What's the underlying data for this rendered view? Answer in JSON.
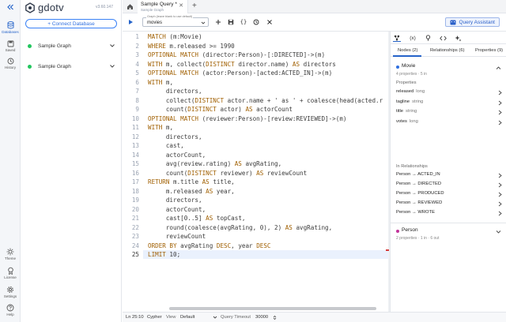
{
  "app": {
    "name": "gdotv",
    "version": "v3.60.147",
    "colors": {
      "accent": "#2563c9",
      "keyword": "#a05f00",
      "code": "#3b3b3b",
      "movie_label": "#2f6fe0",
      "person_label": "#c2339a",
      "connected": "#22c55e"
    }
  },
  "rail": {
    "collapse_icon": "double-chevron-left-icon",
    "items": [
      {
        "label": "Databases",
        "icon": "database-icon"
      },
      {
        "label": "Saved",
        "icon": "save-icon"
      },
      {
        "label": "History",
        "icon": "history-icon"
      },
      {
        "label": "Theme",
        "icon": "sun-icon"
      },
      {
        "label": "License",
        "icon": "license-icon"
      },
      {
        "label": "Settings",
        "icon": "gear-icon"
      },
      {
        "label": "Help",
        "icon": "help-icon"
      }
    ]
  },
  "sidebar": {
    "connect_label": "+ Connect Database",
    "graphs": [
      {
        "name": "Sample Graph",
        "expanded": true
      },
      {
        "name": "Sample Graph",
        "expanded": false
      }
    ]
  },
  "tabs": {
    "home_icon": "home-icon",
    "items": [
      {
        "title": "Sample Query *",
        "subtitle": "Sample Graph"
      }
    ],
    "add_label": "+"
  },
  "toolbar": {
    "graph_select_legend": "Graph (leave blank to use default)",
    "graph_select_value": "movies",
    "assistant_label": "Query Assistant",
    "buttons": [
      "play-icon",
      "plus-icon",
      "save-icon",
      "braces-icon",
      "history-icon",
      "close-icon"
    ]
  },
  "editor": {
    "lines": [
      [
        [
          "MATCH",
          "kw"
        ],
        [
          " (m:Movie)",
          ""
        ]
      ],
      [
        [
          "WHERE",
          "kw"
        ],
        [
          " m.released >= 1990",
          ""
        ]
      ],
      [
        [
          "OPTIONAL MATCH",
          "kw"
        ],
        [
          " (director:Person)-[:DIRECTED]->(m)",
          ""
        ]
      ],
      [
        [
          "WITH",
          "kw"
        ],
        [
          " m, collect(",
          ""
        ],
        [
          "DISTINCT",
          "kw"
        ],
        [
          " director.name) ",
          ""
        ],
        [
          "AS",
          "kw"
        ],
        [
          " directors",
          ""
        ]
      ],
      [
        [
          "OPTIONAL MATCH",
          "kw"
        ],
        [
          " (actor:Person)-[acted:ACTED_IN]->(m)",
          ""
        ]
      ],
      [
        [
          "WITH",
          "kw"
        ],
        [
          " m,",
          ""
        ]
      ],
      [
        [
          "     directors,",
          ""
        ]
      ],
      [
        [
          "     collect(",
          ""
        ],
        [
          "DISTINCT",
          "kw"
        ],
        [
          " actor.name + ' as ' + coalesce(head(acted.r",
          ""
        ]
      ],
      [
        [
          "     count(",
          ""
        ],
        [
          "DISTINCT",
          "kw"
        ],
        [
          " actor) ",
          ""
        ],
        [
          "AS",
          "kw"
        ],
        [
          " actorCount",
          ""
        ]
      ],
      [
        [
          "OPTIONAL MATCH",
          "kw"
        ],
        [
          " (reviewer:Person)-[review:REVIEWED]->(m)",
          ""
        ]
      ],
      [
        [
          "WITH",
          "kw"
        ],
        [
          " m,",
          ""
        ]
      ],
      [
        [
          "     directors,",
          ""
        ]
      ],
      [
        [
          "     cast,",
          ""
        ]
      ],
      [
        [
          "     actorCount,",
          ""
        ]
      ],
      [
        [
          "     avg(review.rating) ",
          ""
        ],
        [
          "AS",
          "kw"
        ],
        [
          " avgRating,",
          ""
        ]
      ],
      [
        [
          "     count(",
          ""
        ],
        [
          "DISTINCT",
          "kw"
        ],
        [
          " reviewer) ",
          ""
        ],
        [
          "AS",
          "kw"
        ],
        [
          " reviewCount",
          ""
        ]
      ],
      [
        [
          "RETURN",
          "kw"
        ],
        [
          " m.title ",
          ""
        ],
        [
          "AS",
          "kw"
        ],
        [
          " title,",
          ""
        ]
      ],
      [
        [
          "     m.released ",
          ""
        ],
        [
          "AS",
          "kw"
        ],
        [
          " year,",
          ""
        ]
      ],
      [
        [
          "     directors,",
          ""
        ]
      ],
      [
        [
          "     actorCount,",
          ""
        ]
      ],
      [
        [
          "     cast[0..5] ",
          ""
        ],
        [
          "AS",
          "kw"
        ],
        [
          " topCast,",
          ""
        ]
      ],
      [
        [
          "     round(coalesce(avgRating, 0), 2) ",
          ""
        ],
        [
          "AS",
          "kw"
        ],
        [
          " avgRating,",
          ""
        ]
      ],
      [
        [
          "     reviewCount",
          ""
        ]
      ],
      [
        [
          "ORDER BY",
          "kw"
        ],
        [
          " avgRating ",
          ""
        ],
        [
          "DESC",
          "kw"
        ],
        [
          ", year ",
          ""
        ],
        [
          "DESC",
          "kw"
        ]
      ],
      [
        [
          "LIMIT",
          "kw"
        ],
        [
          " 10;",
          ""
        ]
      ]
    ],
    "active_line": 25
  },
  "status": {
    "position": "Ln 25:10",
    "language": "Cypher",
    "view_label": "View",
    "view_value": "Default",
    "timeout_label": "Query Timeout",
    "timeout_value": "30000"
  },
  "panel": {
    "icons": [
      "graph-schema-icon",
      "variable-icon",
      "pin-icon",
      "code-icon",
      "ai-sparkle-icon"
    ],
    "tabs": [
      "Nodes (2)",
      "Relationships (6)",
      "Properties (9)"
    ],
    "nodes": [
      {
        "label": "Movie",
        "meta": "4 properties · 5 in",
        "properties_heading": "Properties",
        "properties": [
          {
            "name": "released",
            "type": "long"
          },
          {
            "name": "tagline",
            "type": "string"
          },
          {
            "name": "title",
            "type": "string"
          },
          {
            "name": "votes",
            "type": "long"
          }
        ],
        "relationships_heading": "In Relationships",
        "relationships": [
          "Person → ACTED_IN",
          "Person → DIRECTED",
          "Person → PRODUCED",
          "Person → REVIEWED",
          "Person → WROTE"
        ]
      },
      {
        "label": "Person",
        "meta": "2 properties · 1 in · 6 out"
      }
    ]
  }
}
